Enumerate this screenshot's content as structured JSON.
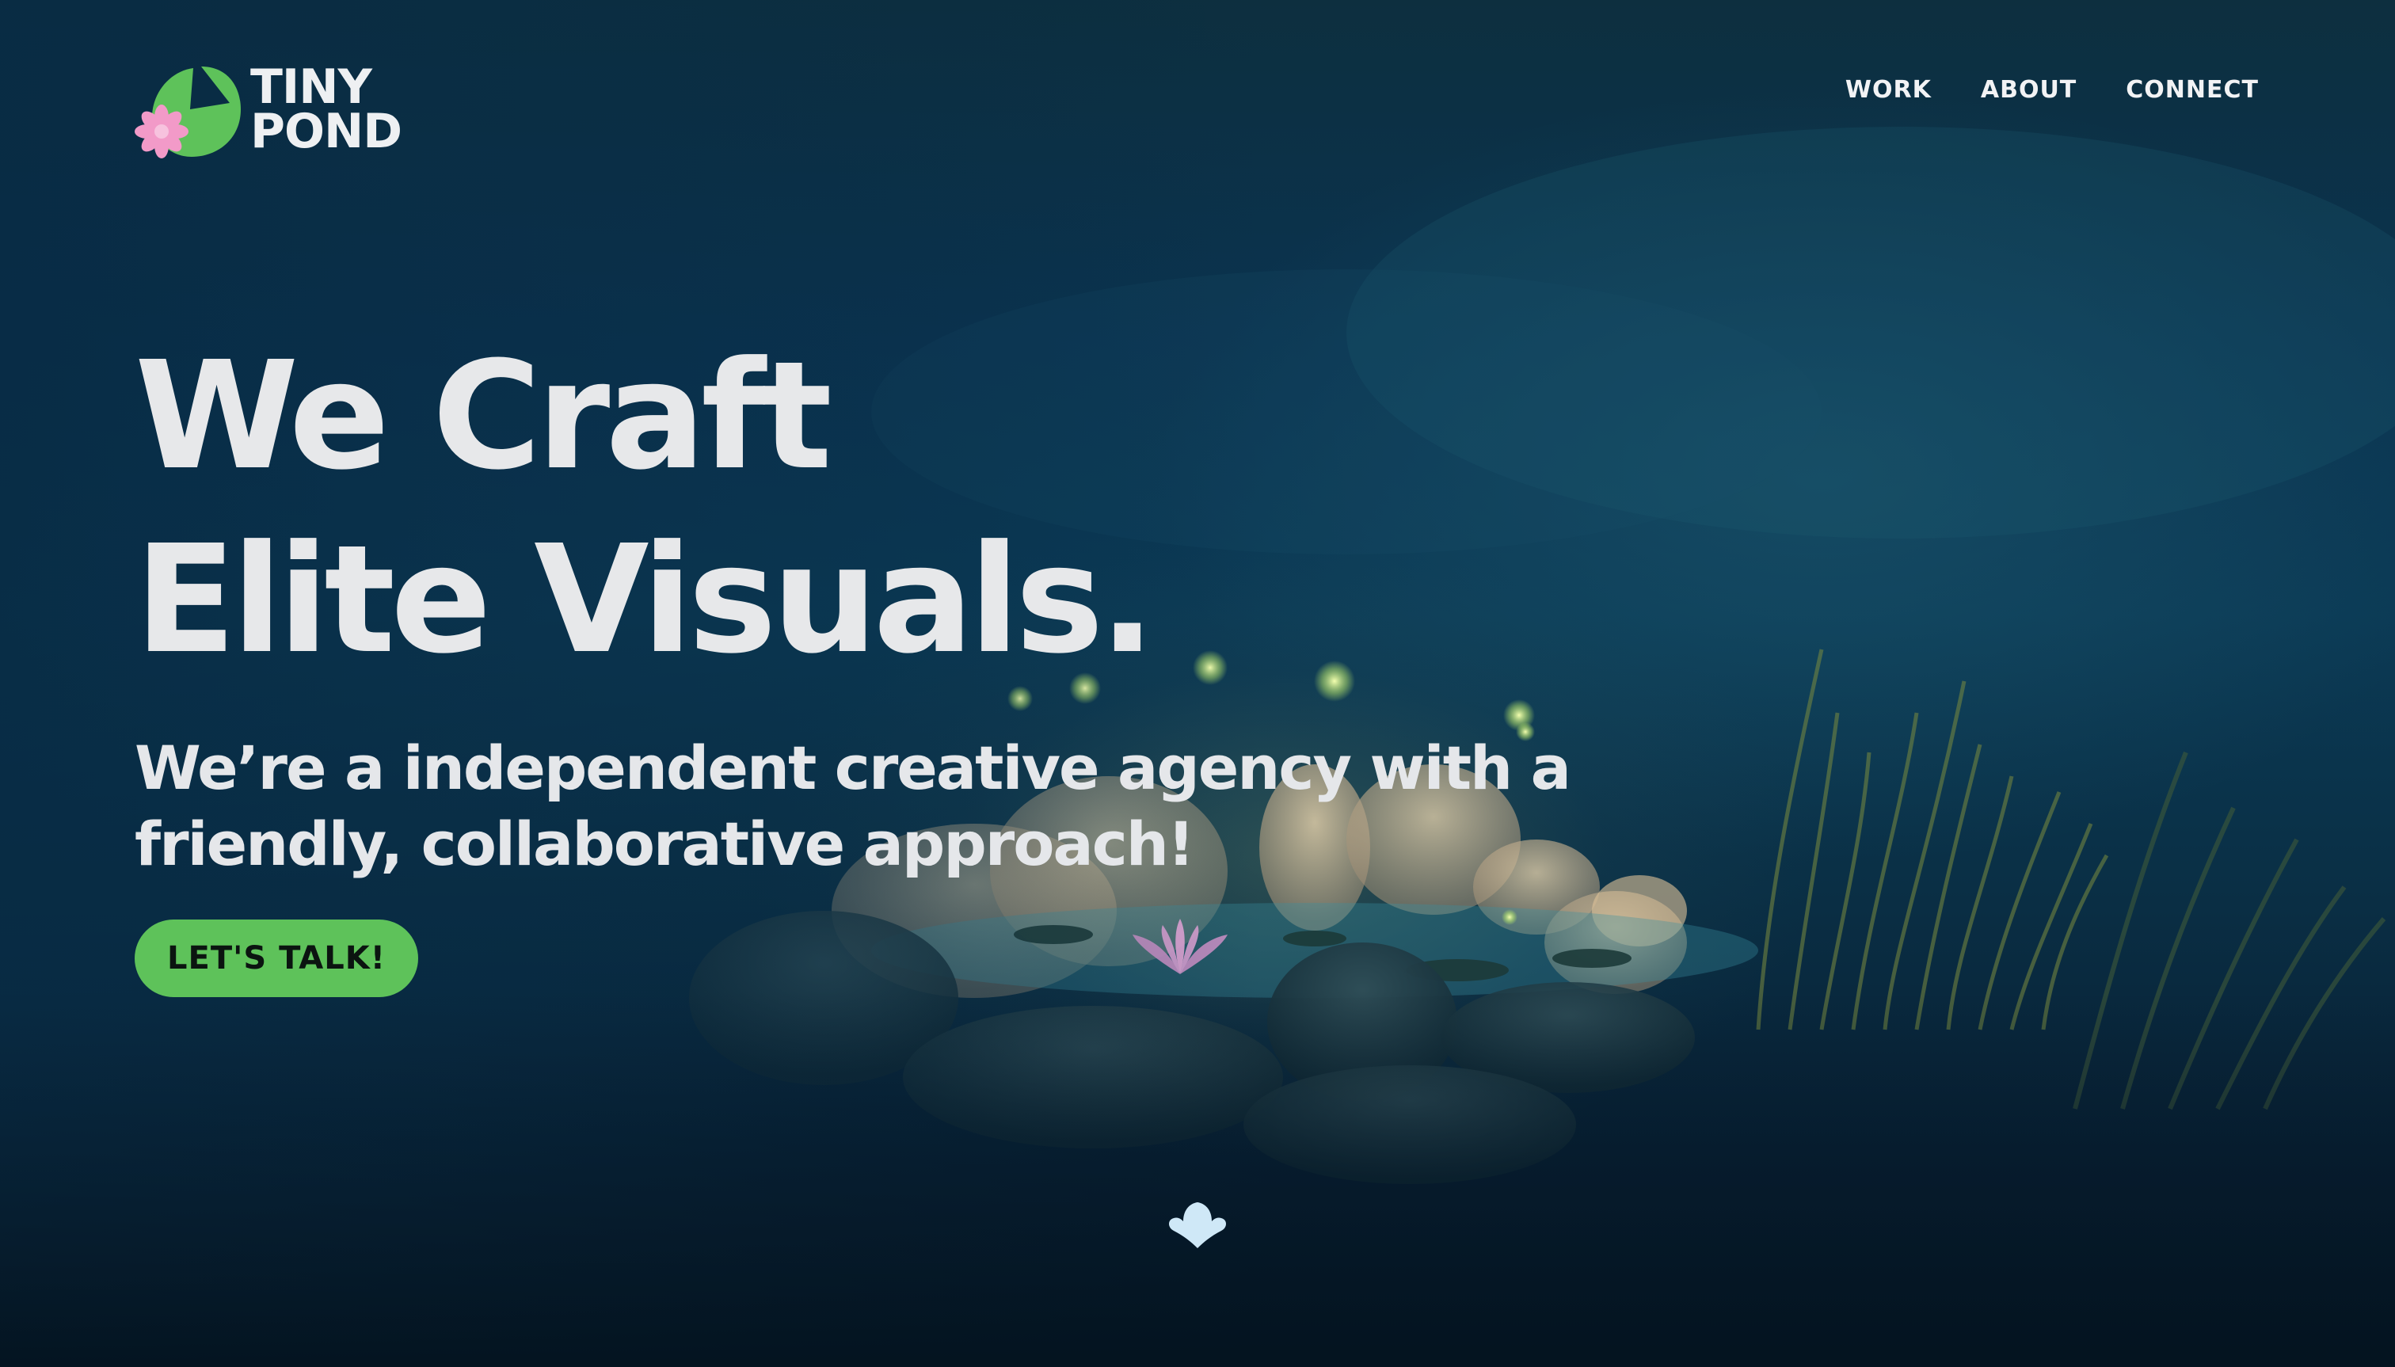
{
  "brand": {
    "name_line1": "TINY",
    "name_line2": "POND",
    "leaf_color": "#5ec25a",
    "flower_color": "#f29ac8"
  },
  "nav": {
    "items": [
      {
        "label": "WORK"
      },
      {
        "label": "ABOUT"
      },
      {
        "label": "CONNECT"
      }
    ]
  },
  "hero": {
    "headline_line1": "We Craft",
    "headline_line2": "Elite Visuals.",
    "subheadline": "We’re a independent creative agency with a friendly, collaborative approach!",
    "cta_label": "LET'S TALK!",
    "cta_color": "#5ec25a",
    "scroll_icon": "lotus-chevron-icon"
  }
}
